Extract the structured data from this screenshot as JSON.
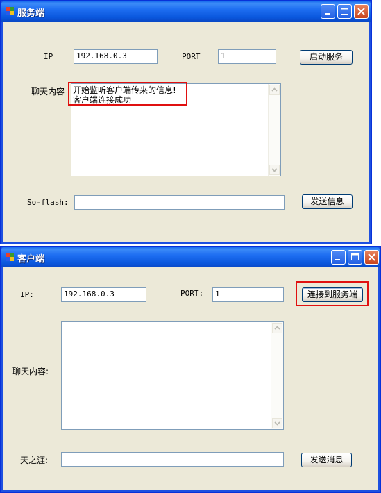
{
  "server": {
    "title": "服务端",
    "ip_label": "IP",
    "ip_value": "192.168.0.3",
    "port_label": "PORT",
    "port_value": "1",
    "start_button": "启动服务",
    "chat_label": "聊天内容",
    "chat_lines": [
      "开始监听客户端传来的信息!",
      "客户端连接成功"
    ],
    "message_label": "So-flash:",
    "message_value": "",
    "send_button": "发送信息"
  },
  "client": {
    "title": "客户端",
    "ip_label": "IP:",
    "ip_value": "192.168.0.3",
    "port_label": "PORT:",
    "port_value": "1",
    "connect_button": "连接到服务端",
    "chat_label": "聊天内容:",
    "chat_lines": [],
    "message_label": "天之涯:",
    "message_value": "",
    "send_button": "发送消息"
  },
  "colors": {
    "highlight": "#e01010",
    "titlebar": "#0a57dd"
  }
}
